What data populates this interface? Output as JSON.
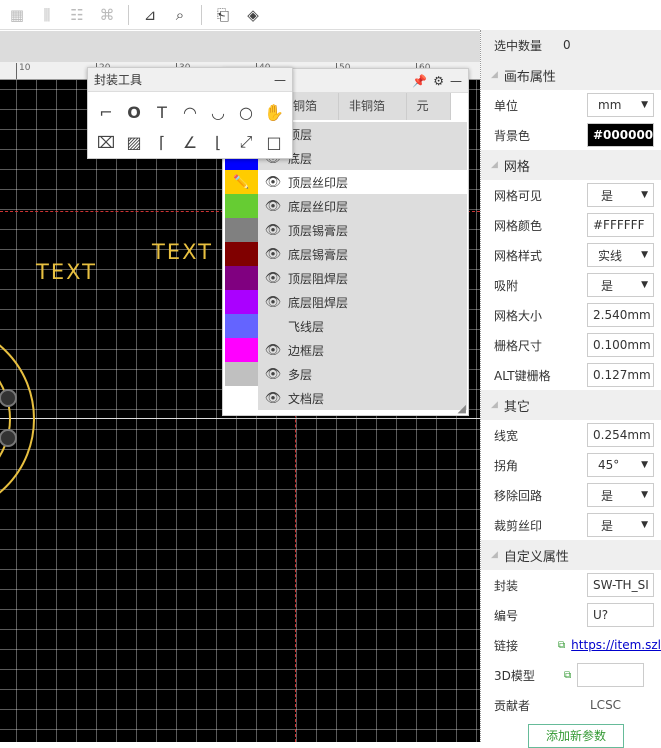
{
  "toolbar": {
    "icons": [
      "grid-icon",
      "align-icon",
      "distribute-icon",
      "group-icon",
      "measure-icon",
      "find-icon",
      "import-icon",
      "layers-icon"
    ]
  },
  "ruler": {
    "labels": [
      "10",
      "20",
      "30",
      "40",
      "50",
      "60"
    ]
  },
  "canvas": {
    "texts": [
      "TEXT",
      "TEXT"
    ],
    "silk_color": "#e8c040"
  },
  "tools_panel": {
    "title": "封装工具",
    "minimize": "—"
  },
  "layers_panel": {
    "tabs": [
      "铜箔层",
      "非铜箔层",
      "元素"
    ],
    "layers": [
      {
        "name": "顶层",
        "color": "#ff0000",
        "visible": true
      },
      {
        "name": "底层",
        "color": "#0000ff",
        "visible": true
      },
      {
        "name": "顶层丝印层",
        "color": "#ffcc00",
        "visible": true,
        "active": true
      },
      {
        "name": "底层丝印层",
        "color": "#66cc33",
        "visible": true
      },
      {
        "name": "顶层锡膏层",
        "color": "#808080",
        "visible": true
      },
      {
        "name": "底层锡膏层",
        "color": "#800000",
        "visible": true
      },
      {
        "name": "顶层阻焊层",
        "color": "#800080",
        "visible": true
      },
      {
        "name": "底层阻焊层",
        "color": "#aa00ff",
        "visible": true
      },
      {
        "name": "飞线层",
        "color": "#6464ff",
        "visible": false
      },
      {
        "name": "边框层",
        "color": "#ff00ff",
        "visible": true
      },
      {
        "name": "多层",
        "color": "#c0c0c0",
        "visible": true
      },
      {
        "name": "文档层",
        "color": "#ffffff",
        "visible": true
      }
    ]
  },
  "props": {
    "selected_label": "选中数量",
    "selected_count": "0",
    "canvas_section": "画布属性",
    "unit_label": "单位",
    "unit": "mm",
    "bg_label": "背景色",
    "bg": "#000000",
    "grid_section": "网格",
    "grid_visible_label": "网格可见",
    "grid_visible": "是",
    "grid_color_label": "网格颜色",
    "grid_color": "#FFFFFF",
    "grid_style_label": "网格样式",
    "grid_style": "实线",
    "snap_label": "吸附",
    "snap": "是",
    "grid_size_label": "网格大小",
    "grid_size": "2.540mm",
    "snap_size_label": "栅格尺寸",
    "snap_size": "0.100mm",
    "alt_label": "ALT键栅格",
    "alt": "0.127mm",
    "other_section": "其它",
    "width_label": "线宽",
    "width": "0.254mm",
    "corner_label": "拐角",
    "corner": "45°",
    "remove_loop_label": "移除回路",
    "remove_loop": "是",
    "clip_silk_label": "裁剪丝印",
    "clip_silk": "是",
    "custom_section": "自定义属性",
    "package_label": "封装",
    "package": "SW-TH_SI",
    "prefix_label": "编号",
    "prefix": "U?",
    "link_label": "链接",
    "link": "https://item.szl",
    "model_label": "3D模型",
    "model": "",
    "contributor_label": "贡献者",
    "contributor": "LCSC",
    "add_param": "添加新参数"
  }
}
